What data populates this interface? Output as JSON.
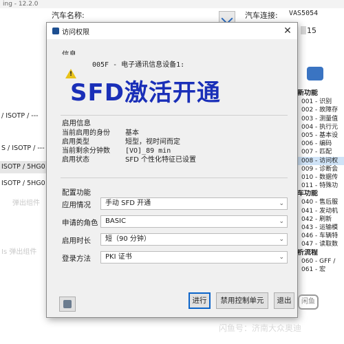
{
  "app": {
    "title_fragment": "ing - 12.2.0",
    "car_name_label": "汽车名称:",
    "connection_label": "汽车连接:",
    "connection_value": "VAS5054",
    "side_value": "15",
    "left_rows": [
      "/ ISOTP / ---",
      "S / ISOTP / ---",
      "ISOTP / 5HG0",
      "ISOTP / 5HG0"
    ],
    "left_faded": [
      "弹出组件",
      "Is 弹出组件"
    ],
    "right_list": [
      {
        "text": "新功能",
        "hdr": true
      },
      {
        "text": "001 - 识别"
      },
      {
        "text": "002 - 故障存"
      },
      {
        "text": "003 - 测量值"
      },
      {
        "text": "004 - 执行元"
      },
      {
        "text": "005 - 基本设"
      },
      {
        "text": "006 - 编码"
      },
      {
        "text": "007 - 匹配"
      },
      {
        "text": "008 - 访问权",
        "sel": true
      },
      {
        "text": "009 - 诊断会"
      },
      {
        "text": "010 - 数据传"
      },
      {
        "text": "011 - 特殊功"
      },
      {
        "text": "车功能",
        "hdr": true
      },
      {
        "text": "040 - 售后服"
      },
      {
        "text": "041 - 发动机"
      },
      {
        "text": "042 - 刷新"
      },
      {
        "text": "043 - 运输模"
      },
      {
        "text": "046 - 车辆特"
      },
      {
        "text": "047 - 读取数"
      },
      {
        "text": "析流程",
        "hdr": true
      },
      {
        "text": "060 - GFF /"
      },
      {
        "text": "061 - 宏"
      }
    ]
  },
  "dialog": {
    "title": "访问权限",
    "close": "✕",
    "info_section": "信息",
    "info_line": "005F - 电子通讯信息设备1:",
    "overlay_text": "SFD激活开通",
    "enable_section": "启用信息",
    "enable_rows": [
      {
        "k": "当前启用的身份",
        "v": "基本"
      },
      {
        "k": "启用类型",
        "v": "短型，视时间而定"
      },
      {
        "k": "当前剩余分钟数",
        "v": "[VO]_89 min"
      },
      {
        "k": "启用状态",
        "v": "SFD 个性化特征已设置"
      }
    ],
    "config_section": "配置功能",
    "config_rows": [
      {
        "label": "应用情况",
        "value": "手动 SFD 开通"
      },
      {
        "label": "申请的角色",
        "value": "BASIC"
      },
      {
        "label": "启用时长",
        "value": "短（90 分钟）"
      },
      {
        "label": "登录方法",
        "value": "PKI 证书"
      }
    ],
    "buttons": {
      "run": "进行",
      "disable": "禁用控制单元",
      "exit": "退出"
    }
  },
  "watermark": "闪鱼号：济南大众奥迪",
  "logo_text": "闲鱼"
}
